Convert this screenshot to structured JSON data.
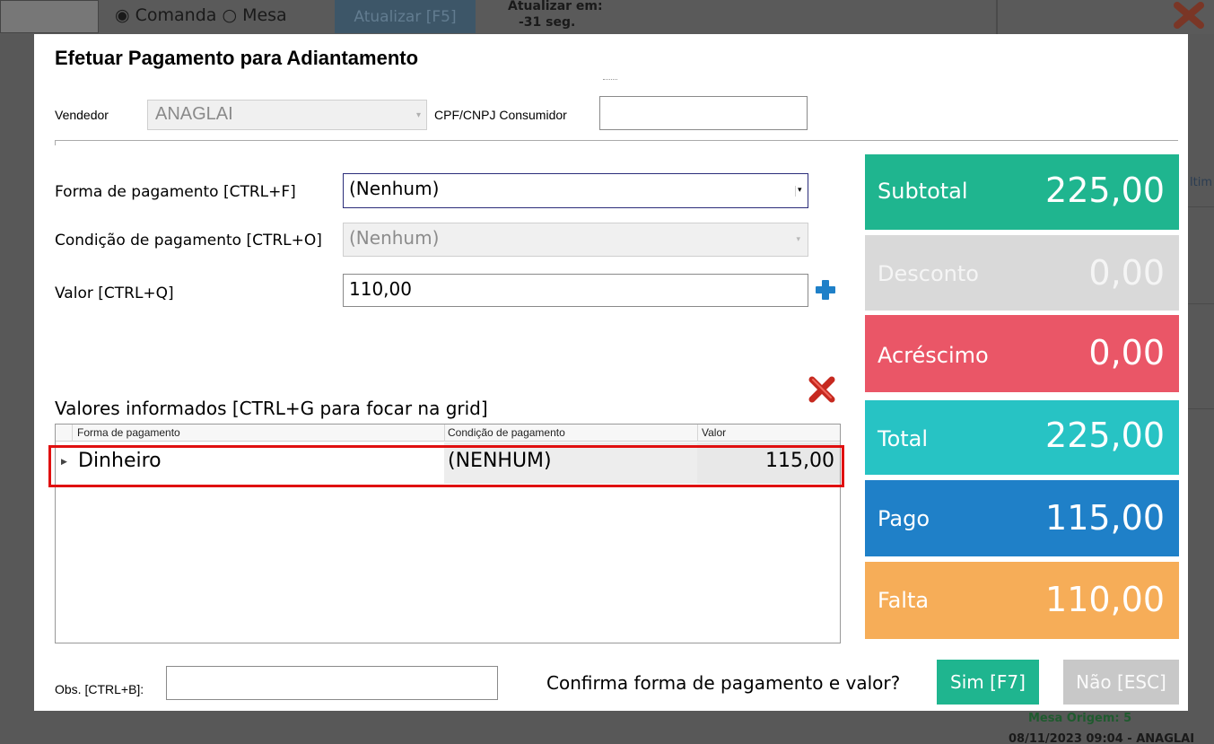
{
  "background": {
    "radio_comanda": "◉ Comanda",
    "radio_mesa": "○ Mesa",
    "refresh_label": "Atualizar [F5]",
    "update_in_label": "Atualizar em:",
    "update_in_value": "-31 seg.",
    "footer_mesa": "Mesa Origem: 5",
    "footer_date": "08/11/2023 09:04 - ANAGLAI",
    "side_text": "ltim"
  },
  "modal": {
    "title": "Efetuar Pagamento para Adiantamento",
    "vendedor_label": "Vendedor",
    "vendedor_value": "ANAGLAI",
    "cpf_label": "CPF/CNPJ Consumidor",
    "cpf_value": "",
    "forma_label": "Forma de pagamento [CTRL+F]",
    "forma_value": "(Nenhum)",
    "condicao_label": "Condição de pagamento [CTRL+O]",
    "condicao_value": "(Nenhum)",
    "valor_label": "Valor [CTRL+Q]",
    "valor_value": "110,00",
    "grid_title": "Valores informados [CTRL+G para focar na grid]",
    "grid": {
      "columns": [
        "Forma de pagamento",
        "Condição de pagamento",
        "Valor"
      ],
      "rows": [
        {
          "forma": "Dinheiro",
          "condicao": "(NENHUM)",
          "valor": "115,00"
        }
      ]
    },
    "totals": {
      "subtotal_label": "Subtotal",
      "subtotal_value": "225,00",
      "desconto_label": "Desconto",
      "desconto_value": "0,00",
      "acrescimo_label": "Acréscimo",
      "acrescimo_value": "0,00",
      "total_label": "Total",
      "total_value": "225,00",
      "pago_label": "Pago",
      "pago_value": "115,00",
      "falta_label": "Falta",
      "falta_value": "110,00"
    },
    "obs_label": "Obs. [CTRL+B]:",
    "obs_value": "",
    "confirm_text": "Confirma forma de pagamento e valor?",
    "sim_label": "Sim [F7]",
    "nao_label": "Não [ESC]"
  },
  "colors": {
    "subtotal": "#1fb58f",
    "desconto": "#d9d9d9",
    "acrescimo": "#ea5667",
    "total": "#27c3c4",
    "pago": "#1f80c8",
    "falta": "#f6ad58",
    "highlight": "#e01010"
  }
}
